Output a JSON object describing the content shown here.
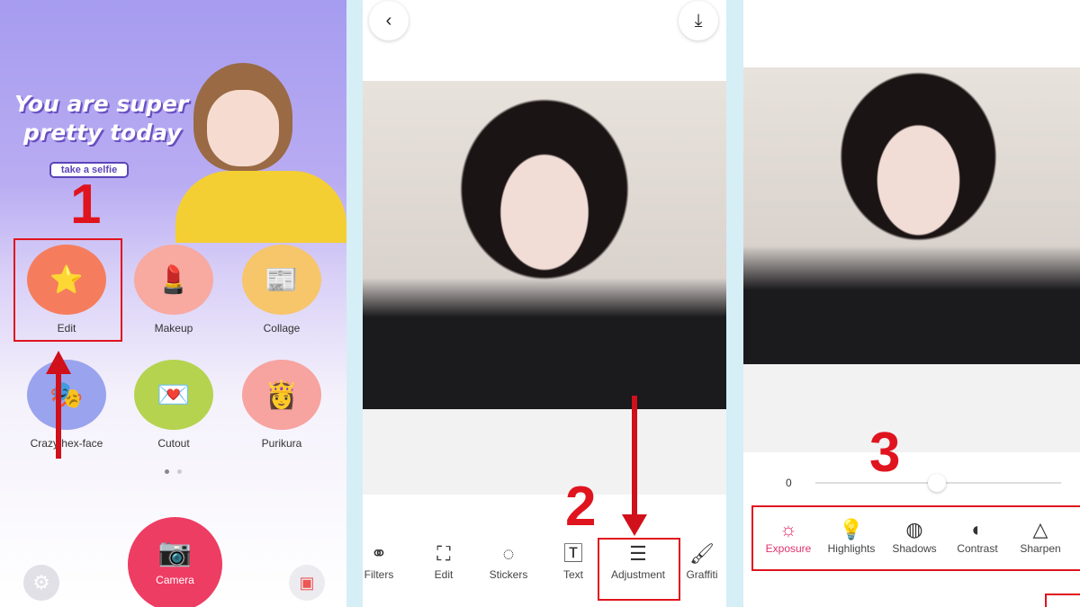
{
  "panel1": {
    "banner_line1": "You are super",
    "banner_line2": "pretty today",
    "selfie_button": "take a selfie",
    "tiles": [
      {
        "label": "Edit",
        "icon": "magic-wand-icon",
        "color": "#f57d5d"
      },
      {
        "label": "Makeup",
        "icon": "lipstick-icon",
        "color": "#f8a9a0"
      },
      {
        "label": "Collage",
        "icon": "collage-icon",
        "color": "#f7c56a"
      },
      {
        "label": "Crazy hex-face",
        "icon": "mask-icon",
        "color": "#9aa3ee"
      },
      {
        "label": "Cutout",
        "icon": "heart-card-icon",
        "color": "#b5d34f"
      },
      {
        "label": "Purikura",
        "icon": "princess-icon",
        "color": "#f7a3a0"
      }
    ],
    "camera_label": "Camera",
    "step": "1"
  },
  "panel2": {
    "tools": [
      {
        "label": "Filters",
        "icon": "filters-icon"
      },
      {
        "label": "Edit",
        "icon": "crop-icon"
      },
      {
        "label": "Stickers",
        "icon": "sticker-icon"
      },
      {
        "label": "Text",
        "icon": "text-icon"
      },
      {
        "label": "Adjustment",
        "icon": "sliders-icon"
      },
      {
        "label": "Graffiti",
        "icon": "brush-icon"
      }
    ],
    "step": "2"
  },
  "panel3": {
    "slider_value": "0",
    "slider_position_percent": 50,
    "adjustments": [
      {
        "label": "Exposure",
        "icon": "exposure-icon",
        "active": true
      },
      {
        "label": "Highlights",
        "icon": "highlights-icon"
      },
      {
        "label": "Shadows",
        "icon": "shadows-icon"
      },
      {
        "label": "Contrast",
        "icon": "contrast-icon"
      },
      {
        "label": "Sharpen",
        "icon": "sharpen-icon"
      }
    ],
    "active_color": "#e0336e",
    "step": "3"
  },
  "annotation_color": "#e0141e"
}
